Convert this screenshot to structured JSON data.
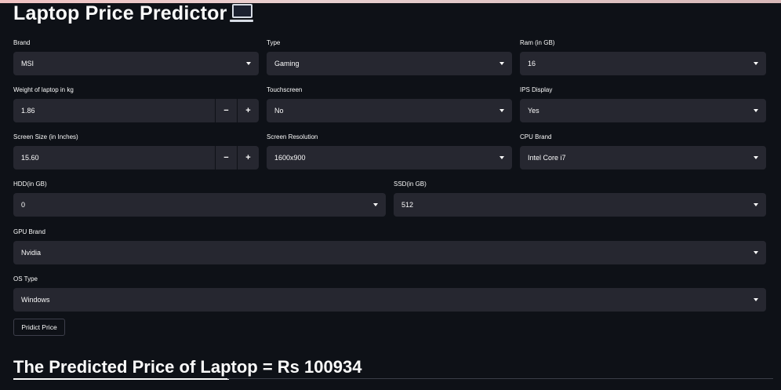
{
  "app": {
    "title": "Laptop Price Predictor",
    "title_icon": "laptop-icon"
  },
  "fields": {
    "brand": {
      "label": "Brand",
      "value": "MSI"
    },
    "type": {
      "label": "Type",
      "value": "Gaming"
    },
    "ram": {
      "label": "Ram (in GB)",
      "value": "16"
    },
    "weight": {
      "label": "Weight of laptop in kg",
      "value": "1.86",
      "minus": "−",
      "plus": "+"
    },
    "touchscreen": {
      "label": "Touchscreen",
      "value": "No"
    },
    "ips": {
      "label": "IPS Display",
      "value": "Yes"
    },
    "screen_size": {
      "label": "Screen Size (in Inches)",
      "value": "15.60",
      "minus": "−",
      "plus": "+"
    },
    "resolution": {
      "label": "Screen Resolution",
      "value": "1600x900"
    },
    "cpu": {
      "label": "CPU Brand",
      "value": "Intel Core i7"
    },
    "hdd": {
      "label": "HDD(in GB)",
      "value": "0"
    },
    "ssd": {
      "label": "SSD(in GB)",
      "value": "512"
    },
    "gpu": {
      "label": "GPU Brand",
      "value": "Nvidia"
    },
    "os": {
      "label": "OS Type",
      "value": "Windows"
    }
  },
  "predict_button": {
    "label": "Pridict Price"
  },
  "result": {
    "text": "The Predicted Price of Laptop = Rs 100934"
  },
  "colors": {
    "background": "#0e1117",
    "input_bg": "#262730",
    "text": "#fafafa",
    "top_accent": "#f0c2c2"
  }
}
